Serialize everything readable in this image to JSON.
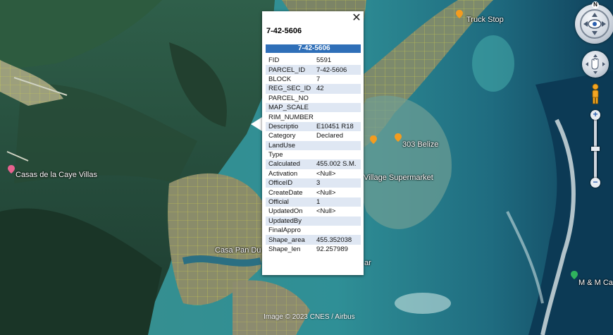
{
  "map": {
    "labels": {
      "truck_stop": "Truck Stop",
      "belize_303": "303 Belize",
      "village_supermarket": "Village Supermarket",
      "casas_de_la_caye": "Casas de la Caye Villas",
      "casa_pan_dulce": "Casa Pan Du",
      "ar": "ar",
      "mm_ca": "M & M Ca"
    },
    "copyright": "Image © 2023 CNES / Airbus"
  },
  "nav": {
    "compass_letter": "N",
    "zoom_in": "+",
    "zoom_out": "−"
  },
  "popup": {
    "close_glyph": "✕",
    "title": "7-42-5606",
    "header": "7-42-5606",
    "rows": [
      {
        "key": "FID",
        "value": "5591"
      },
      {
        "key": "PARCEL_ID",
        "value": "7-42-5606"
      },
      {
        "key": "BLOCK",
        "value": "7"
      },
      {
        "key": "REG_SEC_ID",
        "value": "42"
      },
      {
        "key": "PARCEL_NO",
        "value": ""
      },
      {
        "key": "MAP_SCALE",
        "value": ""
      },
      {
        "key": "RIM_NUMBER",
        "value": ""
      },
      {
        "key": "Descriptio",
        "value": "E10451 R18"
      },
      {
        "key": "Category",
        "value": "Declared"
      },
      {
        "key": "LandUse",
        "value": ""
      },
      {
        "key": "Type",
        "value": ""
      },
      {
        "key": "Calculated",
        "value": "455.002 S.M."
      },
      {
        "key": "Activation",
        "value": "<Null>"
      },
      {
        "key": "OfficeID",
        "value": "3"
      },
      {
        "key": "CreateDate",
        "value": "<Null>"
      },
      {
        "key": "Official",
        "value": "1"
      },
      {
        "key": "UpdatedOn",
        "value": "<Null>"
      },
      {
        "key": "UpdatedBy",
        "value": ""
      },
      {
        "key": "FinalAppro",
        "value": ""
      },
      {
        "key": "Shape_area",
        "value": "455.352038"
      },
      {
        "key": "Shape_len",
        "value": "92.257989"
      }
    ]
  },
  "colors": {
    "header_blue": "#2f6fb8",
    "stripe": "#dfe7f3",
    "parcel_lines": "#e6e23a",
    "pin_orange": "#f39c1f",
    "pin_pink": "#e7628f"
  }
}
